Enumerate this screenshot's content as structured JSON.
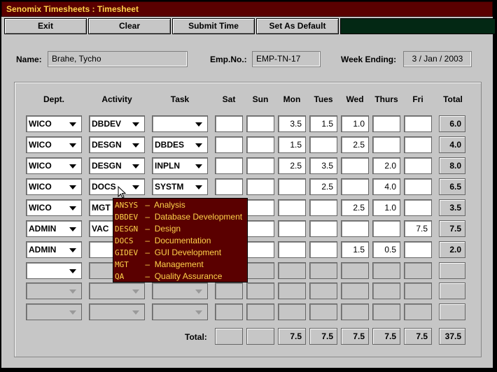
{
  "window": {
    "title": "Senomix Timesheets : Timesheet"
  },
  "toolbar": {
    "exit": "Exit",
    "clear": "Clear",
    "submit": "Submit Time",
    "set_default": "Set As Default",
    "colors": {
      "title_bg": "#5a0000",
      "title_fg": "#ffd24a",
      "panel": "#032814"
    }
  },
  "header": {
    "name_label": "Name:",
    "name_value": "Brahe, Tycho",
    "emp_label": "Emp.No.:",
    "emp_value": "EMP-TN-17",
    "week_label": "Week Ending:",
    "week_value": "3 / Jan / 2003"
  },
  "columns": {
    "dept": "Dept.",
    "activity": "Activity",
    "task": "Task",
    "sat": "Sat",
    "sun": "Sun",
    "mon": "Mon",
    "tues": "Tues",
    "wed": "Wed",
    "thurs": "Thurs",
    "fri": "Fri",
    "total": "Total"
  },
  "rows": [
    {
      "dept": "WICO",
      "activity": "DBDEV",
      "task": "",
      "sat": "",
      "sun": "",
      "mon": "3.5",
      "tues": "1.5",
      "wed": "1.0",
      "thurs": "",
      "fri": "",
      "total": "6.0"
    },
    {
      "dept": "WICO",
      "activity": "DESGN",
      "task": "DBDES",
      "sat": "",
      "sun": "",
      "mon": "1.5",
      "tues": "",
      "wed": "2.5",
      "thurs": "",
      "fri": "",
      "total": "4.0"
    },
    {
      "dept": "WICO",
      "activity": "DESGN",
      "task": "INPLN",
      "sat": "",
      "sun": "",
      "mon": "2.5",
      "tues": "3.5",
      "wed": "",
      "thurs": "2.0",
      "fri": "",
      "total": "8.0"
    },
    {
      "dept": "WICO",
      "activity": "DOCS",
      "task": "SYSTM",
      "sat": "",
      "sun": "",
      "mon": "",
      "tues": "2.5",
      "wed": "",
      "thurs": "4.0",
      "fri": "",
      "total": "6.5"
    },
    {
      "dept": "WICO",
      "activity": "MGT",
      "task": "",
      "sat": "",
      "sun": "",
      "mon": "",
      "tues": "",
      "wed": "2.5",
      "thurs": "1.0",
      "fri": "",
      "total": "3.5"
    },
    {
      "dept": "ADMIN",
      "activity": "VAC",
      "task": "",
      "sat": "",
      "sun": "",
      "mon": "",
      "tues": "",
      "wed": "",
      "thurs": "",
      "fri": "7.5",
      "total": "7.5"
    },
    {
      "dept": "ADMIN",
      "activity": "",
      "task": "",
      "sat": "",
      "sun": "",
      "mon": "",
      "tues": "",
      "wed": "1.5",
      "thurs": "0.5",
      "fri": "",
      "total": "2.0"
    },
    {
      "dept": "",
      "activity": "",
      "task": "",
      "sat": "",
      "sun": "",
      "mon": "",
      "tues": "",
      "wed": "",
      "thurs": "",
      "fri": "",
      "total": ""
    },
    {
      "dept": "",
      "activity": "",
      "task": "",
      "sat": "",
      "sun": "",
      "mon": "",
      "tues": "",
      "wed": "",
      "thurs": "",
      "fri": "",
      "total": ""
    },
    {
      "dept": "",
      "activity": "",
      "task": "",
      "sat": "",
      "sun": "",
      "mon": "",
      "tues": "",
      "wed": "",
      "thurs": "",
      "fri": "",
      "total": ""
    }
  ],
  "totals": {
    "label": "Total:",
    "sat": "",
    "sun": "",
    "mon": "7.5",
    "tues": "7.5",
    "wed": "7.5",
    "thurs": "7.5",
    "fri": "7.5",
    "total": "37.5"
  },
  "activity_menu": [
    {
      "code": "ANSYS",
      "desc": "Analysis"
    },
    {
      "code": "DBDEV",
      "desc": "Database Development"
    },
    {
      "code": "DESGN",
      "desc": "Design"
    },
    {
      "code": "DOCS",
      "desc": "Documentation"
    },
    {
      "code": "GIDEV",
      "desc": "GUI Development"
    },
    {
      "code": "MGT",
      "desc": "Management"
    },
    {
      "code": "QA",
      "desc": "Quality Assurance"
    }
  ]
}
